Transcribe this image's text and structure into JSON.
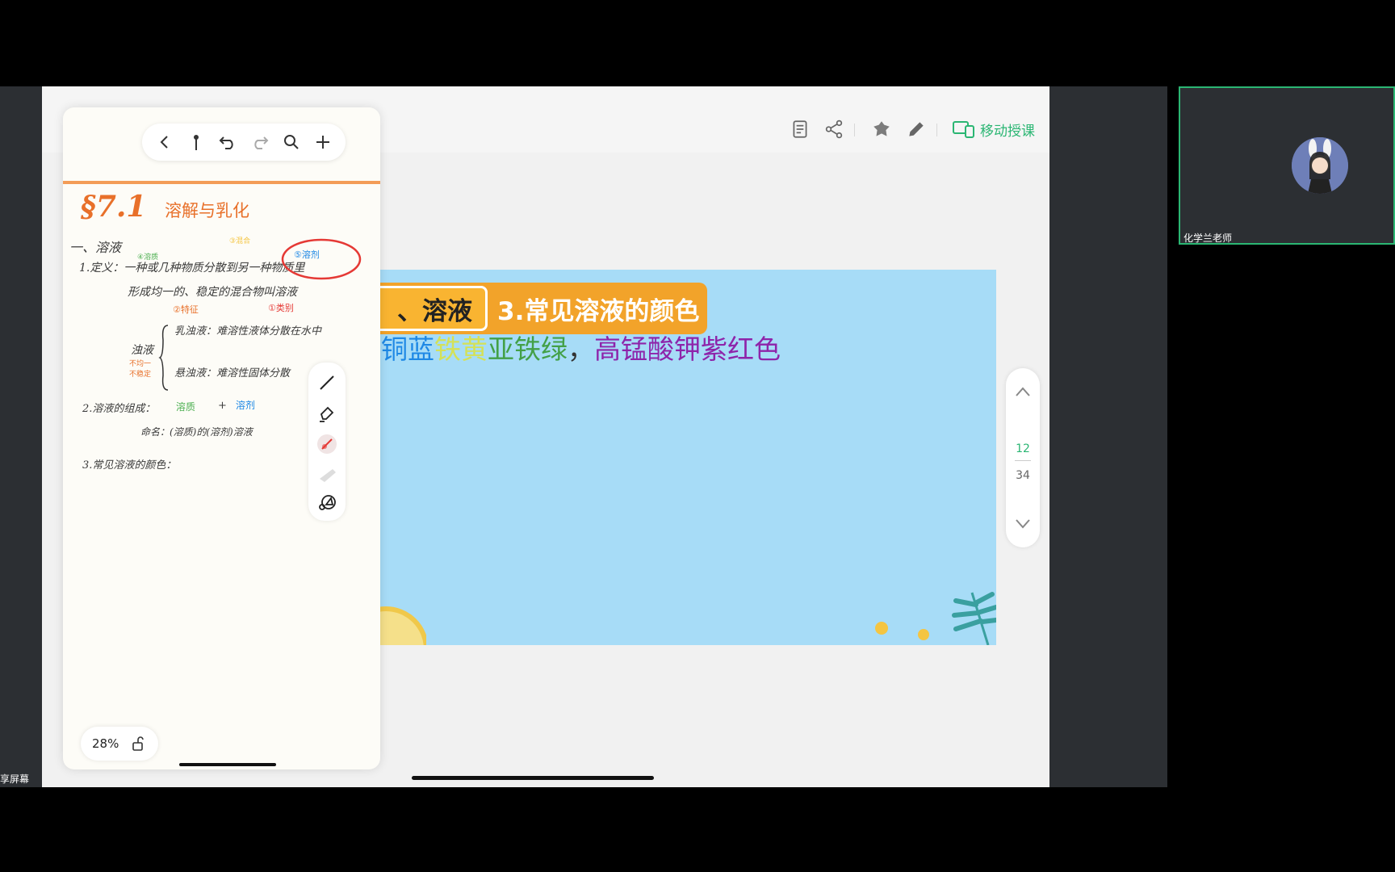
{
  "left_strip": {
    "label": "享屏幕"
  },
  "app_toolbar": {
    "icons": [
      "document-icon",
      "share-icon",
      "game-pad-icon",
      "pen-icon"
    ],
    "mobile_teach_label": "移动授课"
  },
  "slide": {
    "section_label": "、溶液",
    "title": "3.常见溶液的颜色",
    "text_segments": [
      {
        "text": "铜蓝",
        "color": "#1e88e5"
      },
      {
        "text": "铁黄",
        "color": "#d4e157"
      },
      {
        "text": "亚铁绿",
        "color": "#43a047"
      },
      {
        "text": "，",
        "color": "#333333"
      },
      {
        "text": "高锰酸钾紫红色",
        "color": "#8e24aa"
      }
    ]
  },
  "page_nav": {
    "current": "12",
    "total": "34"
  },
  "notes": {
    "heading_num": "§7.1",
    "heading_text": "溶解与乳化",
    "section": "一、溶液",
    "def_line1": "1.定义：一种或几种物质分散到另一种物质里",
    "def_line2": "形成均一的、稳定的混合物叫溶液",
    "ann_solute": "④溶质",
    "ann_solvent_top": "⑤溶剂",
    "ann_char": "②特征",
    "ann_type": "①类别",
    "ann_mix": "③混合",
    "turbid": "浊液",
    "turbid_sub": "不均一 不稳定",
    "emulsion": "乳浊液：难溶性液体分散在水中",
    "suspension": "悬浊液：难溶性固体分散",
    "composition": "2.溶液的组成：",
    "solute": "溶质",
    "plus": "+",
    "solvent": "溶剂",
    "naming": "命名：(溶质)的(溶剂)溶液",
    "colors": "3.常见溶液的颜色：",
    "zoom": "28%"
  },
  "video": {
    "name": "化学兰老师"
  }
}
